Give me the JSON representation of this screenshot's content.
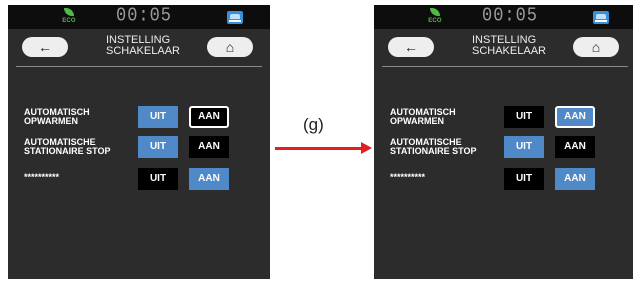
{
  "step_label": "(g)",
  "colors": {
    "selected_blue": "#4f89c8",
    "unselected_black": "#000000",
    "arrow_red": "#e02020",
    "eco_green": "#52b848"
  },
  "screens": [
    {
      "status": {
        "eco_label": "ECO",
        "clock": "00:05",
        "car_icon": "car-icon"
      },
      "header": {
        "back_icon": "←",
        "title_line1": "INSTELLING",
        "title_line2": "SCHAKELAAR",
        "home_icon": "⌂"
      },
      "rows": [
        {
          "label_line1": "AUTOMATISCH",
          "label_line2": "OPWARMEN",
          "off": "UIT",
          "on": "AAN",
          "selected": "AAN"
        },
        {
          "label_line1": "AUTOMATISCHE",
          "label_line2": "STATIONAIRE STOP",
          "off": "UIT",
          "on": "AAN",
          "selected": "UIT"
        },
        {
          "label_line1": "**********",
          "label_line2": "",
          "off": "UIT",
          "on": "AAN",
          "selected": "AAN"
        }
      ]
    },
    {
      "status": {
        "eco_label": "ECO",
        "clock": "00:05",
        "car_icon": "car-icon"
      },
      "header": {
        "back_icon": "←",
        "title_line1": "INSTELLING",
        "title_line2": "SCHAKELAAR",
        "home_icon": "⌂"
      },
      "rows": [
        {
          "label_line1": "AUTOMATISCH",
          "label_line2": "OPWARMEN",
          "off": "UIT",
          "on": "AAN",
          "selected": "AAN"
        },
        {
          "label_line1": "AUTOMATISCHE",
          "label_line2": "STATIONAIRE STOP",
          "off": "UIT",
          "on": "AAN",
          "selected": "UIT"
        },
        {
          "label_line1": "**********",
          "label_line2": "",
          "off": "UIT",
          "on": "AAN",
          "selected": "AAN"
        }
      ]
    }
  ]
}
